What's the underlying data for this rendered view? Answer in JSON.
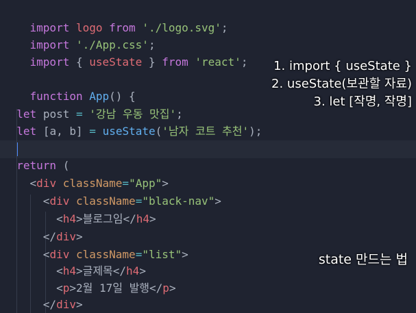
{
  "editor": {
    "lines": {
      "l1": {
        "import": "import",
        "logo": "logo",
        "from": "from",
        "path": "'./logo.svg'",
        "semi": ";"
      },
      "l2": {
        "import": "import",
        "path": "'./App.css'",
        "semi": ";"
      },
      "l3": {
        "import": "import",
        "open": "{ ",
        "name": "useState",
        "close": " }",
        "from": "from",
        "path": "'react'",
        "semi": ";"
      },
      "l5": {
        "function": "function",
        "name": "App",
        "rest": "() {"
      },
      "l7": {
        "let": "let",
        "var": "post",
        "eq": "=",
        "str": "'강남 우동 맛집'",
        "semi": ";"
      },
      "l8": {
        "let": "let",
        "open": "[",
        "a": "a",
        "comma": ", ",
        "b": "b",
        "close": "]",
        "eq": "=",
        "fn": "useState",
        "paren_open": "(",
        "str": "'남자 코트 추천'",
        "paren_close": ");"
      },
      "l10": {
        "return": "return",
        "paren": "("
      },
      "l11": {
        "open": "<",
        "tag": "div",
        "attr": "className",
        "eq": "=",
        "val": "\"App\"",
        "close": ">"
      },
      "l12": {
        "open": "<",
        "tag": "div",
        "attr": "className",
        "eq": "=",
        "val": "\"black-nav\"",
        "close": ">"
      },
      "l13": {
        "open": "<",
        "tag": "h4",
        "close": ">",
        "text": "블로그임",
        "end_open": "</",
        "end_tag": "h4",
        "end_close": ">"
      },
      "l14": {
        "end_open": "</",
        "end_tag": "div",
        "end_close": ">"
      },
      "l15": {
        "open": "<",
        "tag": "div",
        "attr": "className",
        "eq": "=",
        "val": "\"list\"",
        "close": ">"
      },
      "l16": {
        "open": "<",
        "tag": "h4",
        "close": ">",
        "text": "글제목",
        "end_open": "</",
        "end_tag": "h4",
        "end_close": ">"
      },
      "l17": {
        "open": "<",
        "tag": "p",
        "close": ">",
        "text": "2월 17일 발행",
        "end_open": "</",
        "end_tag": "p",
        "end_close": ">"
      },
      "l18": {
        "end_open": "</",
        "end_tag": "div",
        "end_close": ">"
      }
    }
  },
  "notes": {
    "step1": "1. import { useState }",
    "step2": "2. useState(보관할 자료)",
    "step3": "3. let [작명, 작명]",
    "caption": "state 만드는 법"
  }
}
